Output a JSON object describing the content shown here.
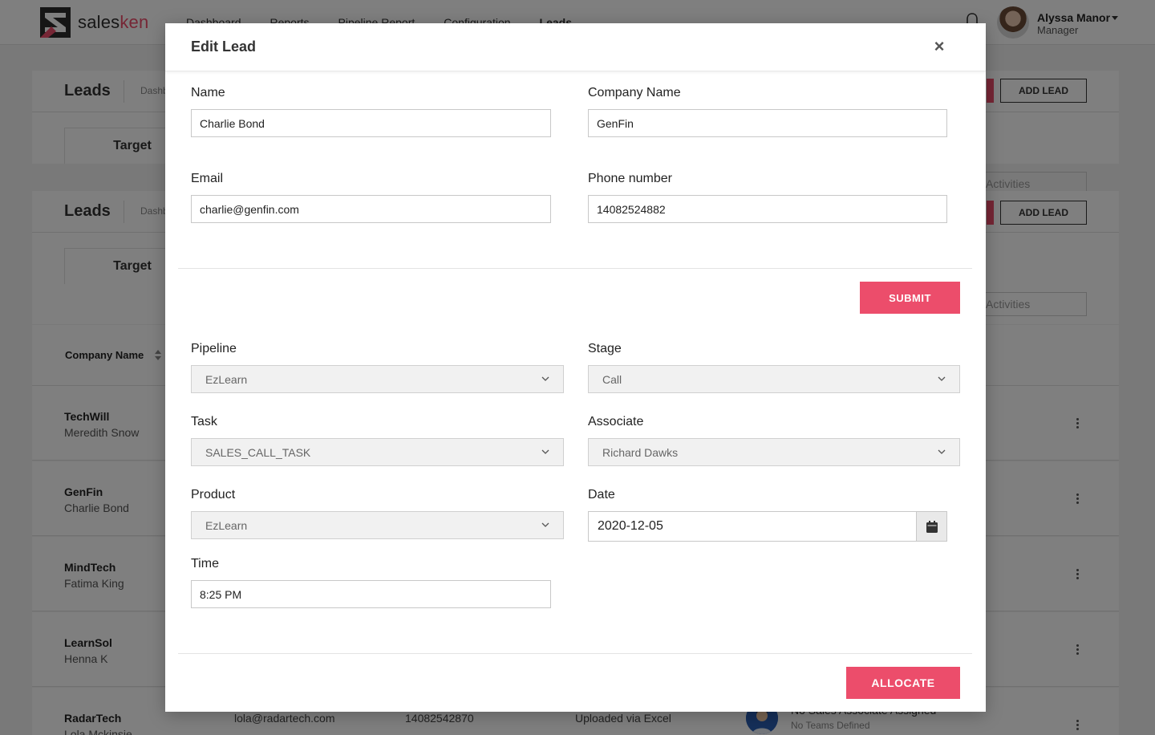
{
  "app": {
    "logo_prefix": "sales",
    "logo_suffix": "ken",
    "nav": [
      {
        "label": "Dashboard",
        "active": false
      },
      {
        "label": "Reports",
        "active": false
      },
      {
        "label": "Pipeline Report",
        "active": false
      },
      {
        "label": "Configuration",
        "active": false
      },
      {
        "label": "Leads",
        "active": true
      }
    ],
    "user": {
      "name": "Alyssa Manor",
      "role": "Manager"
    },
    "brand_color": "#ec4d6b"
  },
  "background": {
    "leads_title": "Leads",
    "breadcrumb": "Dashb",
    "target_tab": "Target",
    "add_lead_label": "ADD LEAD",
    "activities_label": "Activities",
    "table_header_company": "Company Name",
    "rows": [
      {
        "company": "TechWill",
        "contact": "Meredith Snow"
      },
      {
        "company": "GenFin",
        "contact": "Charlie Bond"
      },
      {
        "company": "MindTech",
        "contact": "Fatima King"
      },
      {
        "company": "LearnSol",
        "contact": "Henna K"
      },
      {
        "company": "RadarTech",
        "contact": "Lola Mckinsie",
        "email": "lola@radartech.com",
        "phone": "14082542870",
        "source": "Uploaded via Excel",
        "associate": "No Sales Associate Assigned",
        "team": "No Teams Defined"
      }
    ]
  },
  "modal": {
    "title": "Edit Lead",
    "close_icon": "×",
    "name_label": "Name",
    "name_value": "Charlie Bond",
    "company_label": "Company Name",
    "company_value": "GenFin",
    "email_label": "Email",
    "email_value": "charlie@genfin.com",
    "phone_label": "Phone number",
    "phone_value": "14082524882",
    "submit_label": "SUBMIT",
    "pipeline_label": "Pipeline",
    "pipeline_value": "EzLearn",
    "stage_label": "Stage",
    "stage_value": "Call",
    "task_label": "Task",
    "task_value": "SALES_CALL_TASK",
    "associate_label": "Associate",
    "associate_value": "Richard Dawks",
    "product_label": "Product",
    "product_value": "EzLearn",
    "date_label": "Date",
    "date_value": "2020-12-05",
    "time_label": "Time",
    "time_value": "8:25 PM",
    "allocate_label": "ALLOCATE"
  }
}
